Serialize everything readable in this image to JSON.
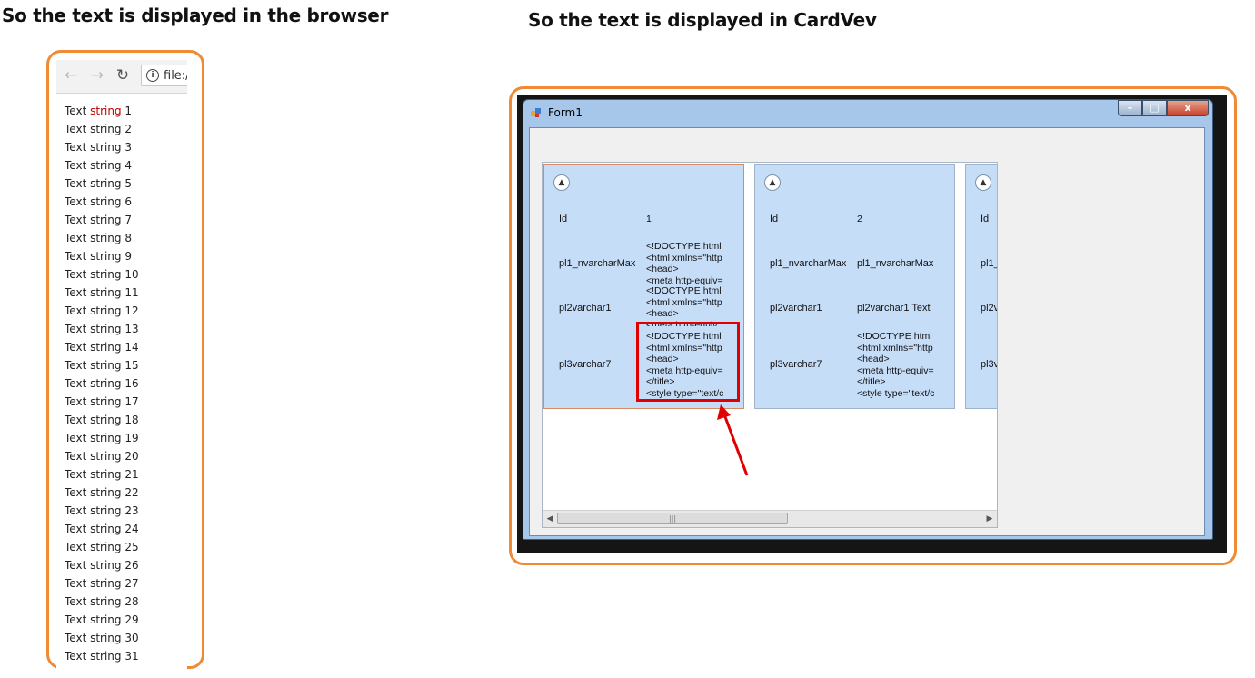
{
  "headings": {
    "browser": "So the text is displayed in the browser",
    "cardview": "So the text is displayed in CardVev"
  },
  "browser": {
    "address_text": "file:/",
    "icons": [
      "back-icon",
      "forward-icon",
      "reload-icon",
      "info-icon"
    ],
    "first_line": {
      "word1": "Text",
      "word2": "string",
      "word3": "1"
    },
    "lines": [
      "Text string 2",
      "Text string 3",
      "Text string 4",
      "Text string 5",
      "Text string 6",
      "Text string 7",
      "Text string 8",
      "Text string 9",
      "Text string 10",
      "Text string 11",
      "Text string 12",
      "Text string 13",
      "Text string 14",
      "Text string 15",
      "Text string 16",
      "Text string 17",
      "Text string 18",
      "Text string 19",
      "Text string 20",
      "Text string 21",
      "Text string 22",
      "Text string 23",
      "Text string 24",
      "Text string 25",
      "Text string 26",
      "Text string 27",
      "Text string 28",
      "Text string 29",
      "Text string 30",
      "Text string 31"
    ],
    "highlight_color": "#c00000"
  },
  "form": {
    "title": "Form1",
    "buttons": {
      "minimize": "–",
      "maximize": "□",
      "close": "x"
    },
    "cards": [
      {
        "rows": [
          {
            "label": "Id",
            "value": "1"
          },
          {
            "label": "pl1_nvarcharMax",
            "value": "<!DOCTYPE html\n<html xmlns=\"http\n<head>\n<meta http-equiv="
          },
          {
            "label": "pl2varchar1",
            "value": "<!DOCTYPE html\n<html xmlns=\"http\n<head>\n<meta http-equiv"
          },
          {
            "label": "pl3varchar7",
            "value": "<!DOCTYPE html\n<html xmlns=\"http\n<head>\n<meta http-equiv=\n</title>\n<style type=\"text/c"
          }
        ]
      },
      {
        "rows": [
          {
            "label": "Id",
            "value": "2"
          },
          {
            "label": "pl1_nvarcharMax",
            "value": "pl1_nvarcharMax"
          },
          {
            "label": "pl2varchar1",
            "value": "pl2varchar1 Text"
          },
          {
            "label": "pl3varchar7",
            "value": "<!DOCTYPE html\n<html xmlns=\"http\n<head>\n<meta http-equiv=\n</title>\n<style type=\"text/c"
          }
        ]
      },
      {
        "rows": [
          {
            "label": "Id",
            "value": ""
          },
          {
            "label": "pl1_",
            "value": ""
          },
          {
            "label": "pl2v",
            "value": ""
          },
          {
            "label": "pl3v",
            "value": ""
          }
        ]
      }
    ],
    "scroll_grip": "|||"
  },
  "colors": {
    "frame": "#f08a33",
    "highlight_box": "#e00000",
    "card_bg": "#c6ddf8"
  }
}
